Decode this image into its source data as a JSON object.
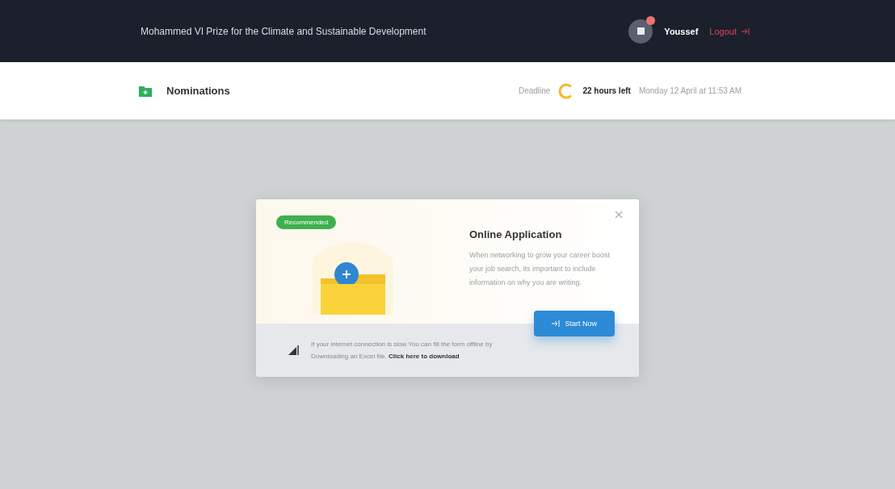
{
  "header": {
    "title": "Mohammed VI Prize for the Climate and Sustainable Development",
    "user": {
      "name": "Youssef",
      "has_notification": true
    },
    "logout": "Logout"
  },
  "subheader": {
    "section": "Nominations",
    "deadline_label": "Deadline",
    "time_left": "22 hours left",
    "deadline_date": "Monday 12 April at 11:53 AM"
  },
  "modal": {
    "badge": "Recommended",
    "title": "Online Application",
    "description": "When networking to grow your career boost your job search, its important to include information on why you are writing.",
    "button": "Start Now",
    "notice": "If your internet connection is slow You can fill the form offline by Downloading an Excel file. **Click here to download**"
  }
}
